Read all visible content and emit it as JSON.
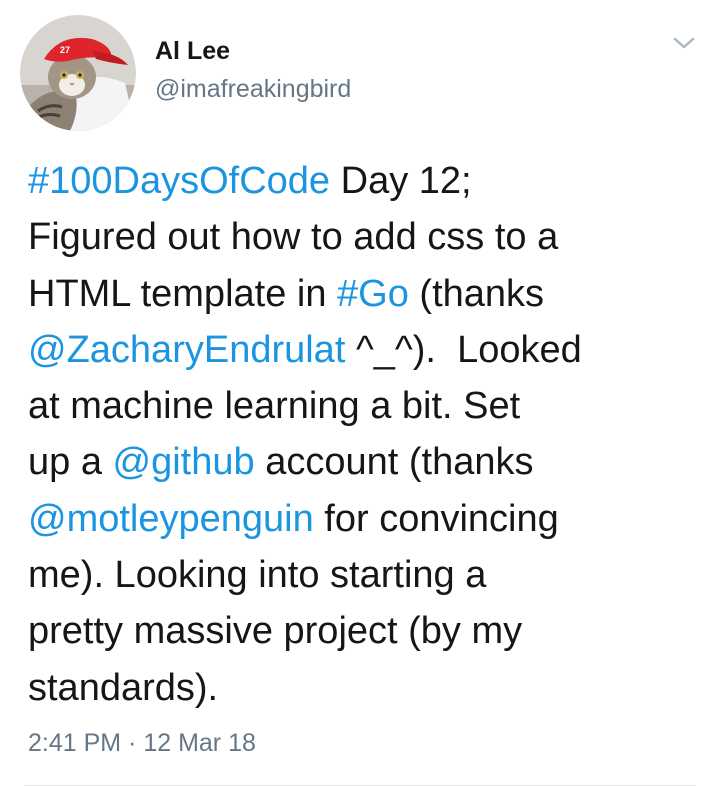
{
  "author": {
    "name": "Al Lee",
    "handle": "@imafreakingbird",
    "avatar_icon": "cat-in-red-cap-avatar"
  },
  "menu": {
    "icon": "chevron-down-icon"
  },
  "tweet": {
    "lines": [
      [
        {
          "text": "#100DaysOfCode",
          "type": "hashtag"
        },
        {
          "text": " Day 12;",
          "type": "text"
        }
      ],
      [
        {
          "text": "Figured out how to add css to a",
          "type": "text"
        }
      ],
      [
        {
          "text": "HTML template in ",
          "type": "text"
        },
        {
          "text": "#Go",
          "type": "hashtag"
        },
        {
          "text": " (thanks",
          "type": "text"
        }
      ],
      [
        {
          "text": "@ZacharyEndrulat",
          "type": "mention"
        },
        {
          "text": " ^_^).  Looked",
          "type": "text"
        }
      ],
      [
        {
          "text": "at machine learning a bit. Set",
          "type": "text"
        }
      ],
      [
        {
          "text": "up a ",
          "type": "text"
        },
        {
          "text": "@github",
          "type": "mention"
        },
        {
          "text": " account (thanks",
          "type": "text"
        }
      ],
      [
        {
          "text": "@motleypenguin",
          "type": "mention"
        },
        {
          "text": " for convincing",
          "type": "text"
        }
      ],
      [
        {
          "text": "me). Looking into starting a",
          "type": "text"
        }
      ],
      [
        {
          "text": "pretty massive project (by my",
          "type": "text"
        }
      ],
      [
        {
          "text": "standards).",
          "type": "text"
        }
      ]
    ],
    "timestamp": "2:41 PM · 12 Mar 18"
  },
  "colors": {
    "link": "#1b95e0",
    "secondary_text": "#657786",
    "primary_text": "#14171a",
    "divider": "#e1e8ed"
  }
}
